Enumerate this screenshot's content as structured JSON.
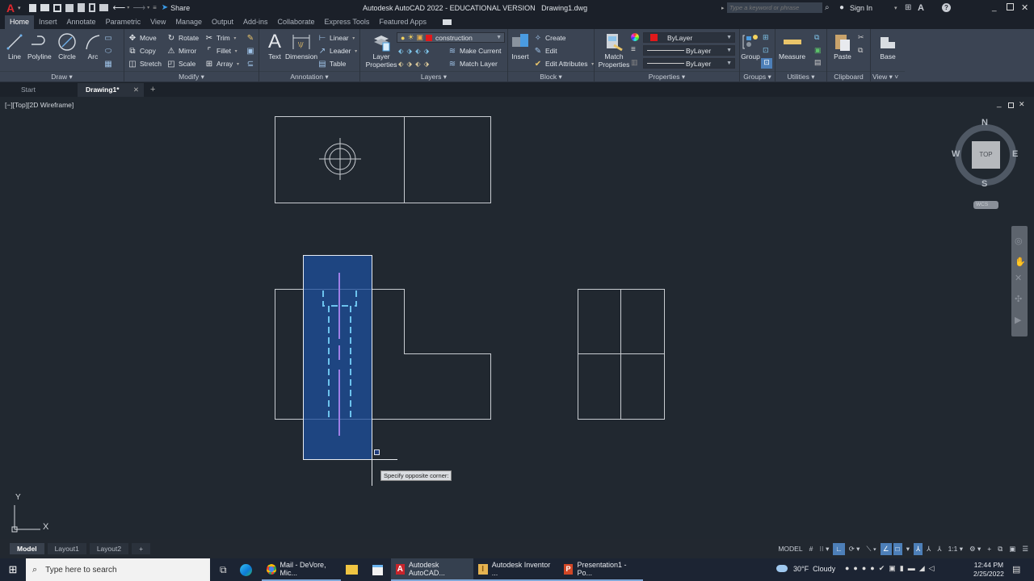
{
  "titlebar": {
    "app_menu_icon": "autocad-a-icon",
    "qat_items": [
      "new-icon",
      "open-icon",
      "save-icon",
      "save-as-icon",
      "plot-preview-icon",
      "publish-icon",
      "print-icon",
      "undo-icon",
      "redo-icon",
      "customize-qat-icon"
    ],
    "share_label": "Share",
    "title": "Autodesk AutoCAD 2022 - EDUCATIONAL VERSION",
    "filename": "Drawing1.dwg",
    "search_placeholder": "Type a keyword or phrase",
    "sign_in": "Sign In"
  },
  "ribbon_tabs": [
    "Home",
    "Insert",
    "Annotate",
    "Parametric",
    "View",
    "Manage",
    "Output",
    "Add-ins",
    "Collaborate",
    "Express Tools",
    "Featured Apps"
  ],
  "active_ribbon_tab": "Home",
  "panels": {
    "draw": {
      "title": "Draw",
      "buttons": [
        "Line",
        "Polyline",
        "Circle",
        "Arc"
      ]
    },
    "modify": {
      "title": "Modify",
      "col1": [
        "Move",
        "Copy",
        "Stretch"
      ],
      "col2": [
        "Rotate",
        "Mirror",
        "Scale"
      ],
      "col3": [
        "Trim",
        "Fillet",
        "Array"
      ]
    },
    "annotation": {
      "title": "Annotation",
      "big": [
        "Text",
        "Dimension"
      ],
      "small": [
        "Linear",
        "Leader",
        "Table"
      ]
    },
    "layers": {
      "title": "Layers",
      "layer_properties": "Layer Properties",
      "current_layer": "construction",
      "layer_color": "#e0191b",
      "make_current": "Make Current",
      "match_layer": "Match Layer"
    },
    "block": {
      "title": "Block",
      "insert": "Insert",
      "items": [
        "Create",
        "Edit",
        "Edit Attributes"
      ]
    },
    "properties": {
      "title": "Properties",
      "match_properties": "Match Properties",
      "color": "ByLayer",
      "linetype": "ByLayer",
      "lineweight": "ByLayer",
      "color_swatch": "#e0191b"
    },
    "groups": {
      "title": "Groups",
      "group": "Group"
    },
    "utilities": {
      "title": "Utilities",
      "measure": "Measure"
    },
    "clipboard": {
      "title": "Clipboard",
      "paste": "Paste"
    },
    "view": {
      "title": "View",
      "base": "Base"
    }
  },
  "doc_tabs": [
    {
      "label": "Start"
    },
    {
      "label": "Drawing1*",
      "active": true
    }
  ],
  "viewport_label": "[−][Top][2D Wireframe]",
  "viewcube": {
    "n": "N",
    "s": "S",
    "e": "E",
    "w": "W",
    "face": "TOP",
    "ucs": "WCS"
  },
  "ucs_icon": {
    "x": "X",
    "y": "Y"
  },
  "tooltip": "Specify opposite corner:",
  "layout_tabs": [
    "Model",
    "Layout1",
    "Layout2"
  ],
  "status_bar": {
    "model": "MODEL",
    "scale": "1:1"
  },
  "taskbar": {
    "search_placeholder": "Type here to search",
    "apps": [
      {
        "label": "Mail - DeVore, Mic...",
        "icon": "chrome-icon"
      },
      {
        "label": "Autodesk AutoCAD...",
        "icon": "autocad-icon",
        "active": true
      },
      {
        "label": "Autodesk Inventor ...",
        "icon": "inventor-icon"
      },
      {
        "label": "Presentation1 - Po...",
        "icon": "powerpoint-icon"
      }
    ],
    "weather": "30°F  Cloudy",
    "time": "12:44 PM",
    "date": "2/25/2022"
  }
}
